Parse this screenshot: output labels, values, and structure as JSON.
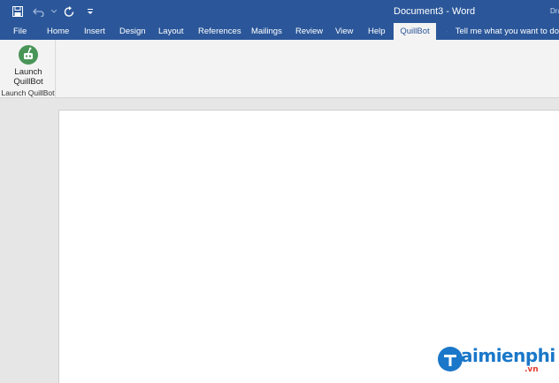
{
  "window": {
    "title": "Document3  -  Word",
    "corner_text": "Dra"
  },
  "quick_access": {
    "icons": [
      "save-icon",
      "undo-icon",
      "redo-icon",
      "customize-qat-icon"
    ]
  },
  "tabs": [
    {
      "label": "File",
      "active": false
    },
    {
      "label": "Home",
      "active": false
    },
    {
      "label": "Insert",
      "active": false
    },
    {
      "label": "Design",
      "active": false
    },
    {
      "label": "Layout",
      "active": false
    },
    {
      "label": "References",
      "active": false
    },
    {
      "label": "Mailings",
      "active": false
    },
    {
      "label": "Review",
      "active": false
    },
    {
      "label": "View",
      "active": false
    },
    {
      "label": "Help",
      "active": false
    },
    {
      "label": "QuillBot",
      "active": true
    }
  ],
  "tell_me": {
    "label": "Tell me what you want to do"
  },
  "ribbon": {
    "launch_button_line1": "Launch",
    "launch_button_line2": "QuillBot",
    "group_label": "Launch QuillBot"
  },
  "watermark": {
    "text": "aimienphi",
    "suffix": ".vn"
  },
  "colors": {
    "accent": "#2b579a",
    "quillbot_green": "#499557",
    "watermark_blue": "#1a77c9",
    "watermark_red": "#e23a2a"
  }
}
